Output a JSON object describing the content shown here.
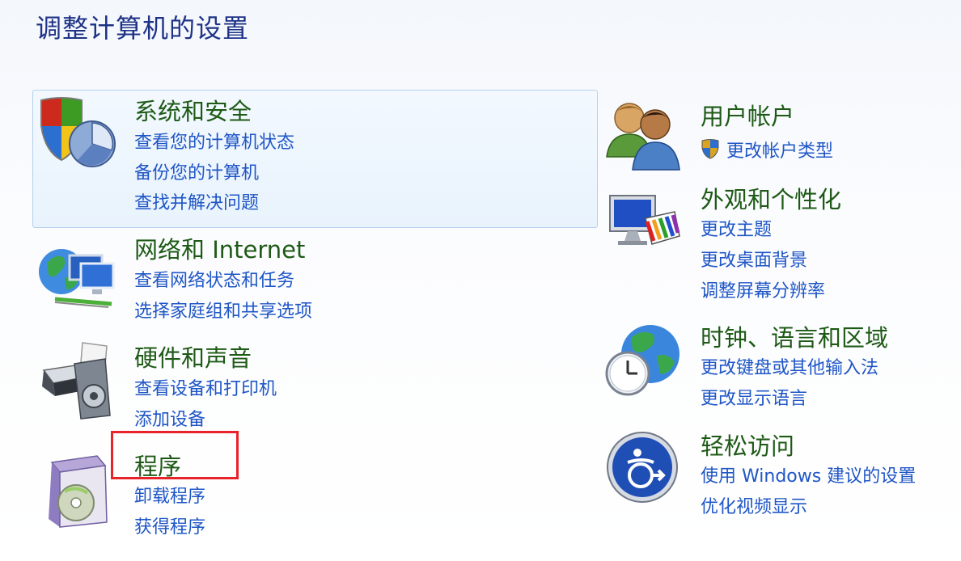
{
  "page": {
    "title": "调整计算机的设置"
  },
  "categories": {
    "system_security": {
      "title": "系统和安全",
      "links": [
        "查看您的计算机状态",
        "备份您的计算机",
        "查找并解决问题"
      ]
    },
    "network": {
      "title": "网络和 Internet",
      "links": [
        "查看网络状态和任务",
        "选择家庭组和共享选项"
      ]
    },
    "hardware": {
      "title": "硬件和声音",
      "links": [
        "查看设备和打印机",
        "添加设备"
      ]
    },
    "programs": {
      "title": "程序",
      "links": [
        "卸载程序",
        "获得程序"
      ]
    },
    "user_accounts": {
      "title": "用户帐户",
      "links": [
        "更改帐户类型"
      ]
    },
    "appearance": {
      "title": "外观和个性化",
      "links": [
        "更改主题",
        "更改桌面背景",
        "调整屏幕分辨率"
      ]
    },
    "clock_region": {
      "title": "时钟、语言和区域",
      "links": [
        "更改键盘或其他输入法",
        "更改显示语言"
      ]
    },
    "ease_access": {
      "title": "轻松访问",
      "links": [
        "使用 Windows 建议的设置",
        "优化视频显示"
      ]
    }
  },
  "icons": {
    "system_security": "shield-chart-icon",
    "network": "network-globe-icon",
    "hardware": "printer-speaker-icon",
    "programs": "program-box-icon",
    "user_accounts": "users-icon",
    "appearance": "monitor-palette-icon",
    "clock_region": "globe-clock-icon",
    "ease_access": "ease-of-access-icon"
  },
  "colors": {
    "title_blue": "#1e3287",
    "category_green": "#1e5a16",
    "link_blue": "#1f56c6",
    "highlight_red": "#e8242a"
  }
}
